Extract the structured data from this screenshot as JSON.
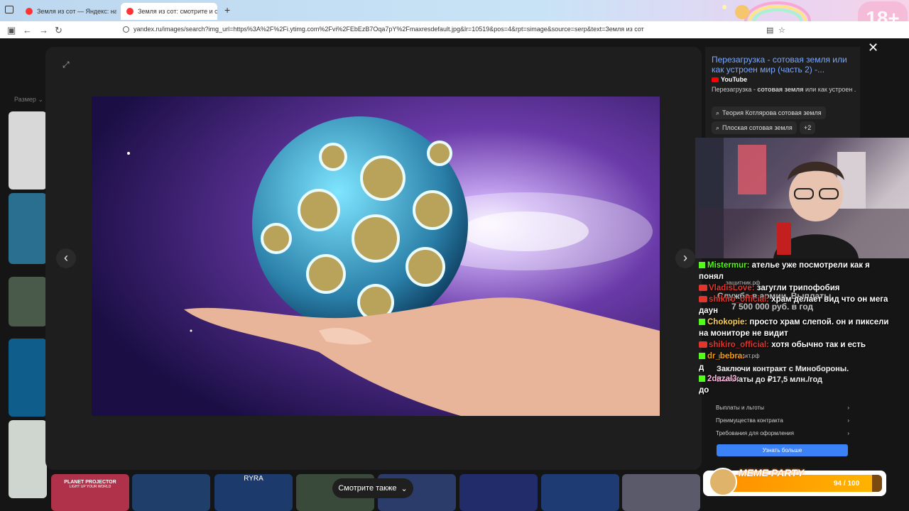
{
  "browser": {
    "tabs": [
      {
        "label": "Земля из сот — Яндекс: нашло..."
      },
      {
        "label": "Земля из сот: смотрите и скач..."
      }
    ],
    "url": "yandex.ru/images/search?img_url=https%3A%2F%2Fi.ytimg.com%2Fvi%2FEbEzB7Oqa7pY%2Fmaxresdefault.jpg&lr=10519&pos=4&rpt=simage&source=serp&text=Земля из сот",
    "badge": "18+"
  },
  "page": {
    "filter_label": "Размер"
  },
  "viewer": {
    "title": "Перезагрузка - сотовая земля или как устроен мир (часть 2) -...",
    "source": "YouTube",
    "description_pre": "Перезагрузка - ",
    "description_bold": "сотовая земля",
    "description_post": " или как устроен ...",
    "chips": [
      "Теория Котлярова сотовая земля",
      "Плоская сотовая земля",
      "+2"
    ],
    "see_also": "Смотрите также",
    "thumb_labels": [
      "PLANET PROJECTOR",
      "LIGHT UP YOUR WORLD",
      "RYRA"
    ]
  },
  "chat": {
    "messages": [
      {
        "user": "Mistermur:",
        "text": " ателье уже посмотрели как я понял",
        "color": "#53fc18"
      },
      {
        "user": "VladisLove:",
        "text": " загугли трипофобия",
        "color": "#e3352e"
      },
      {
        "user": "shikiro_official:",
        "text": " храм делает вид  что он мега даун",
        "color": "#e3352e"
      },
      {
        "user": "Chokopie:",
        "text": " просто храм слепой. он и пиксели на мониторе не видит",
        "color": "#ffd24a"
      },
      {
        "user": "shikiro_official:",
        "text": " хотя обычно так и есть",
        "color": "#e3352e"
      },
      {
        "user": "dr_bebra:",
        "text": "",
        "color": "#ff9a00"
      },
      {
        "user": "",
        "text": "д",
        "color": "#fff"
      },
      {
        "user": "2dazal3:",
        "text": "",
        "color": "#ffb3e0"
      },
      {
        "user": "",
        "text": "до",
        "color": "#fff"
      }
    ]
  },
  "ad": {
    "line1": "Служба в армии. Выплаты",
    "line2": "7 500 000 руб. в год",
    "site": "защитник.рф",
    "site2": "росконтракт.рф",
    "headline": "Заключи контракт с Минобороны. Выплаты до ₽17,5 млн./год",
    "rows": [
      "Выплаты и льготы",
      "Преимущества контракта",
      "Требования для оформления"
    ],
    "button": "Узнать больше"
  },
  "overlay": {
    "meme_title": "MEME PARTY",
    "meme_count": "94 / 100",
    "meme_progress": 0.94
  },
  "colors": {
    "accent_link": "#7aa7ff",
    "ad_button": "#3b82f6",
    "kick_green": "#53fc18"
  }
}
